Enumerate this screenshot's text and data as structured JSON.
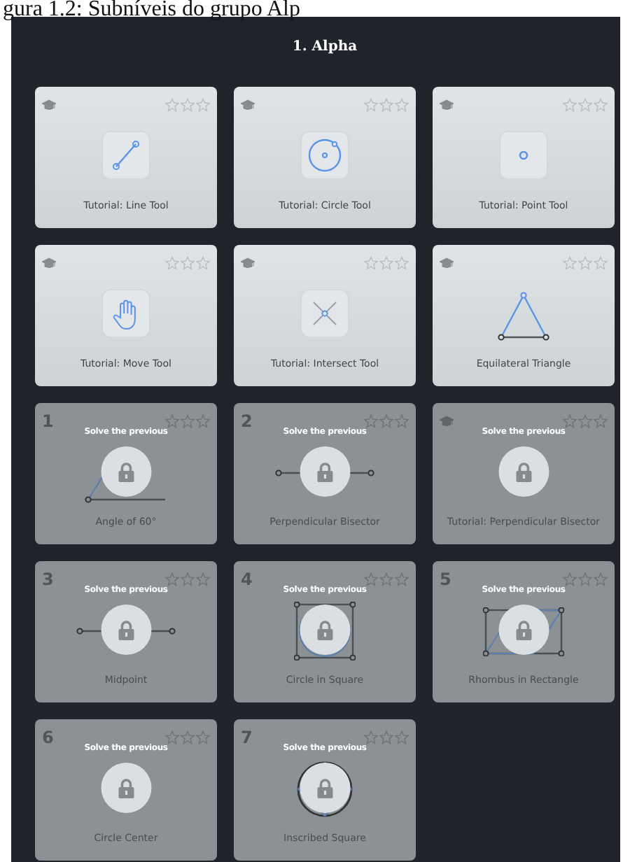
{
  "caption": "gura 1.2: Subníveis do grupo Alp",
  "group_title": "1. Alpha",
  "levels": [
    {
      "kind": "line",
      "tutorial": true,
      "title": "Tutorial: Line Tool",
      "stars": 0,
      "locked": false
    },
    {
      "kind": "circle",
      "tutorial": true,
      "title": "Tutorial: Circle Tool",
      "stars": 0,
      "locked": false
    },
    {
      "kind": "point",
      "tutorial": true,
      "title": "Tutorial: Point Tool",
      "stars": 0,
      "locked": false
    },
    {
      "kind": "move",
      "tutorial": true,
      "title": "Tutorial: Move Tool",
      "stars": 0,
      "locked": false
    },
    {
      "kind": "intersect",
      "tutorial": true,
      "title": "Tutorial: Intersect Tool",
      "stars": 0,
      "locked": false
    },
    {
      "kind": "triangle",
      "tutorial": true,
      "title": "Equilateral Triangle",
      "stars": 0,
      "locked": false
    },
    {
      "kind": "angle",
      "tutorial": false,
      "number": "1",
      "title": "Angle of 60°",
      "stars": 0,
      "locked": true,
      "lock_text": "Solve the previous"
    },
    {
      "kind": "segment",
      "tutorial": false,
      "number": "2",
      "title": "Perpendicular Bisector",
      "stars": 0,
      "locked": true,
      "lock_text": "Solve the previous"
    },
    {
      "kind": "blank",
      "tutorial": true,
      "title": "Tutorial: Perpendicular Bisector",
      "stars": 0,
      "locked": true,
      "lock_text": "Solve the previous"
    },
    {
      "kind": "segment",
      "tutorial": false,
      "number": "3",
      "title": "Midpoint",
      "stars": 0,
      "locked": true,
      "lock_text": "Solve the previous"
    },
    {
      "kind": "circle-square",
      "tutorial": false,
      "number": "4",
      "title": "Circle in Square",
      "stars": 0,
      "locked": true,
      "lock_text": "Solve the previous"
    },
    {
      "kind": "rhombus",
      "tutorial": false,
      "number": "5",
      "title": "Rhombus in Rectangle",
      "stars": 0,
      "locked": true,
      "lock_text": "Solve the previous"
    },
    {
      "kind": "blank",
      "tutorial": false,
      "number": "6",
      "title": "Circle Center",
      "stars": 0,
      "locked": true,
      "lock_text": "Solve the previous"
    },
    {
      "kind": "inscribed",
      "tutorial": false,
      "number": "7",
      "title": "Inscribed Square",
      "stars": 0,
      "locked": true,
      "lock_text": "Solve the previous"
    }
  ]
}
